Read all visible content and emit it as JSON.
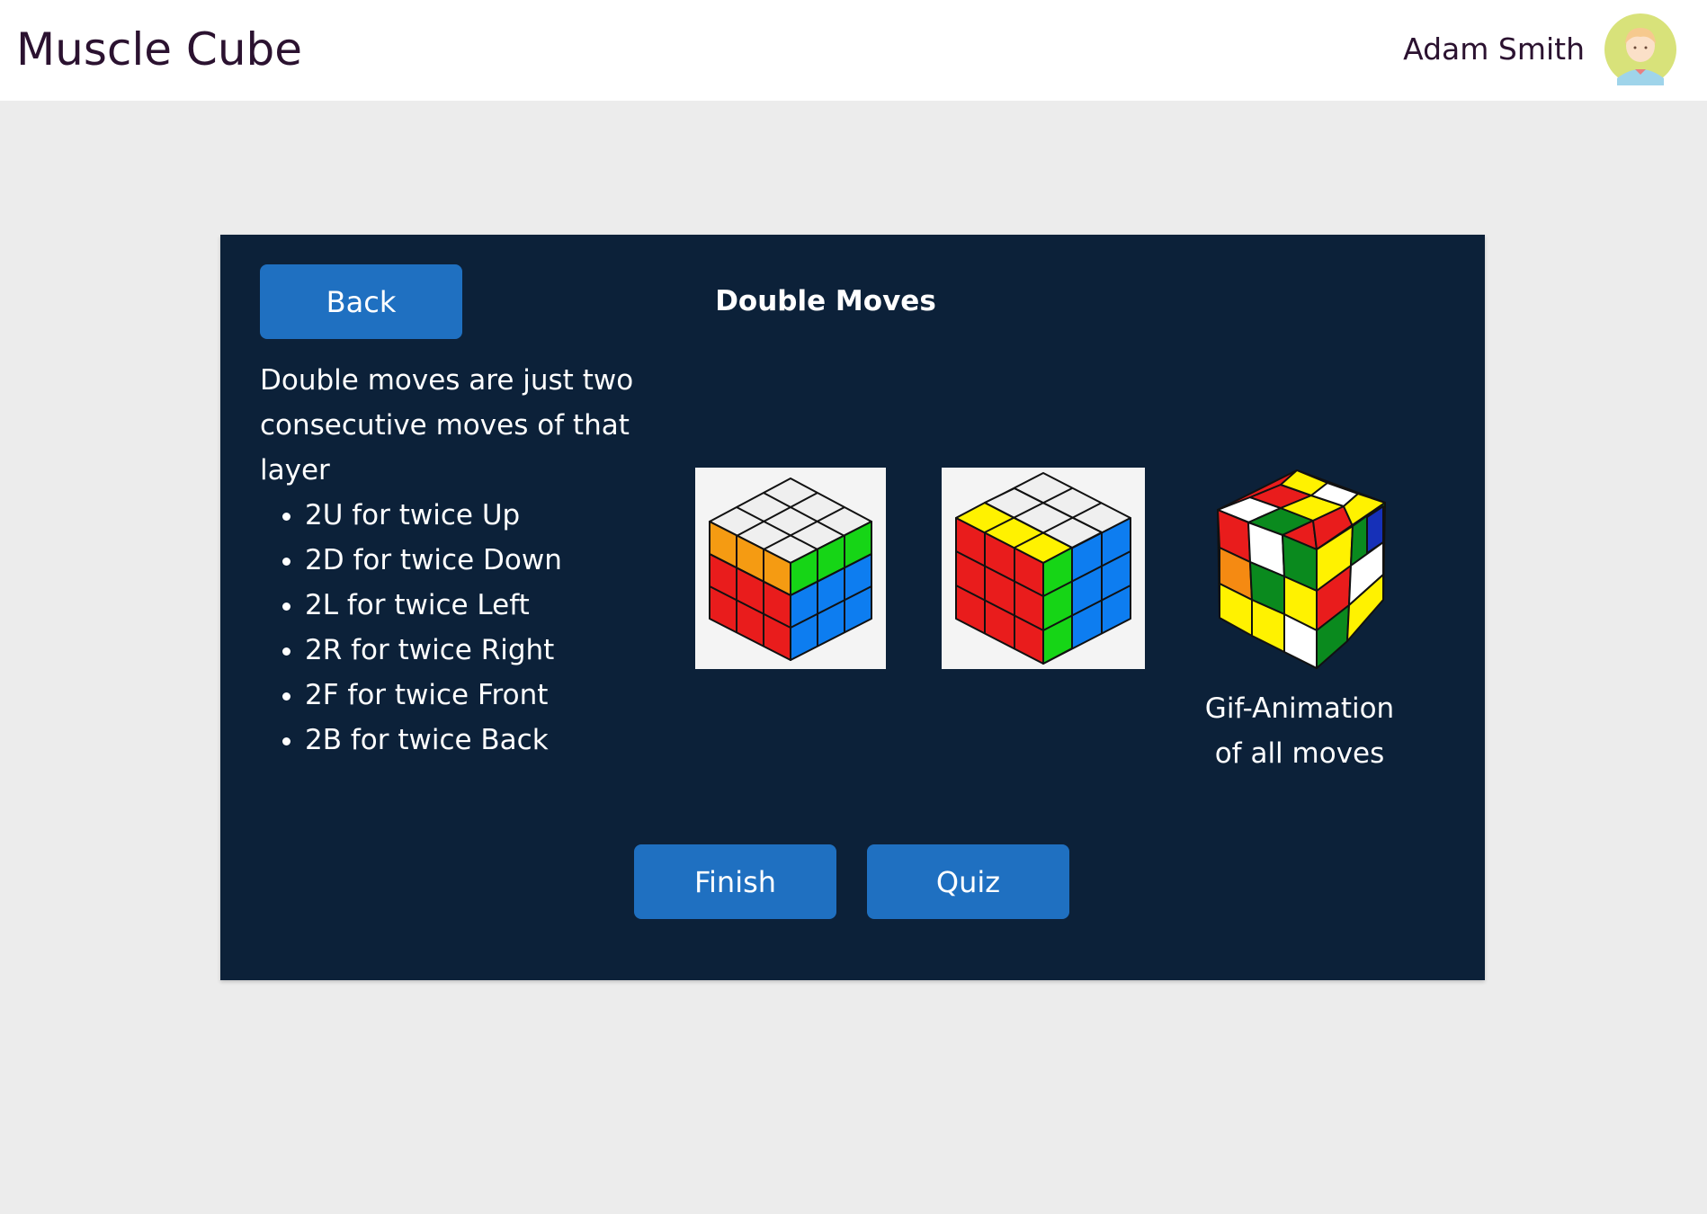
{
  "header": {
    "app_title": "Muscle Cube",
    "user_name": "Adam Smith",
    "avatar_icon": "user-avatar-icon"
  },
  "card": {
    "back_label": "Back",
    "title": "Double Moves",
    "intro": "Double moves are just two consecutive moves of that layer",
    "moves": [
      "2U for twice Up",
      "2D for twice Down",
      "2L for twice Left",
      "2R for twice Right",
      "2F for twice Front",
      "2B for twice Back"
    ],
    "gif_caption_line1": "Gif-Animation",
    "gif_caption_line2": "of all moves",
    "finish_label": "Finish",
    "quiz_label": "Quiz"
  },
  "colors": {
    "card_bg": "#0c2139",
    "button_bg": "#1f70c1",
    "page_bg": "#ececec",
    "title_text": "#2b1230"
  }
}
